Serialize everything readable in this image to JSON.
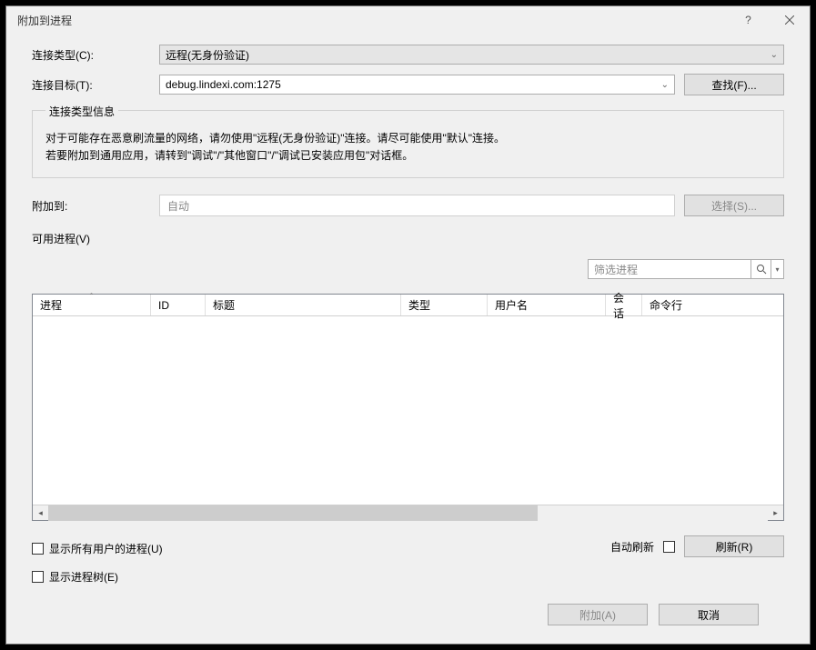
{
  "title": "附加到进程",
  "help_icon": "?",
  "connection_type_label": "连接类型(C):",
  "connection_type_value": "远程(无身份验证)",
  "connection_target_label": "连接目标(T):",
  "connection_target_value": "debug.lindexi.com:1275",
  "find_button": "查找(F)...",
  "info_legend": "连接类型信息",
  "info_line1": "对于可能存在恶意刷流量的网络，请勿使用\"远程(无身份验证)\"连接。请尽可能使用\"默认\"连接。",
  "info_line2": "若要附加到通用应用，请转到\"调试\"/\"其他窗口\"/\"调试已安装应用包\"对话框。",
  "attach_to_label": "附加到:",
  "attach_to_value": "自动",
  "select_button": "选择(S)...",
  "available_label": "可用进程(V)",
  "filter_placeholder": "筛选进程",
  "columns": {
    "process": "进程",
    "id": "ID",
    "title": "标题",
    "type": "类型",
    "user": "用户名",
    "session": "会话",
    "cmdline": "命令行"
  },
  "show_all_users": "显示所有用户的进程(U)",
  "show_tree": "显示进程树(E)",
  "auto_refresh": "自动刷新",
  "refresh_button": "刷新(R)",
  "attach_button": "附加(A)",
  "cancel_button": "取消"
}
